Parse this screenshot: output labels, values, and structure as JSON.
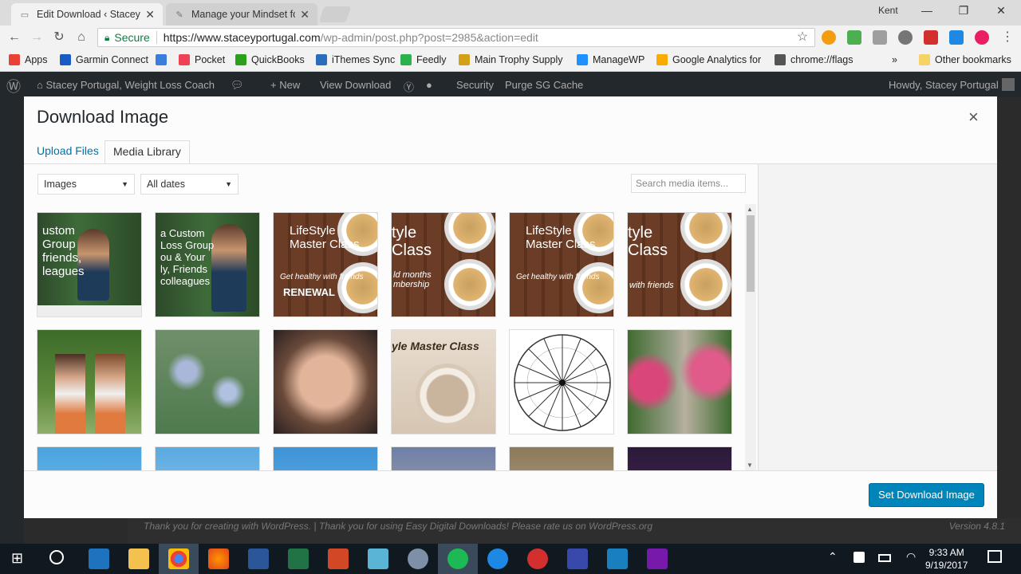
{
  "browser": {
    "tabs": [
      {
        "label": "Edit Download ‹ Stacey P",
        "icon": "document-icon"
      },
      {
        "label": "Manage your Mindset fo",
        "icon": "leaf-icon"
      }
    ],
    "profile": "Kent",
    "address": {
      "secure_label": "Secure",
      "host": "https://www.staceyportugal.com",
      "path": "/wp-admin/post.php?post=2985&action=edit"
    },
    "bookmarks": [
      {
        "label": "Apps",
        "color": "#e94235"
      },
      {
        "label": "Garmin Connect",
        "color": "#1a5bc4"
      },
      {
        "label": "",
        "color": "#3b7ddd"
      },
      {
        "label": "Pocket",
        "color": "#ef4056"
      },
      {
        "label": "QuickBooks",
        "color": "#2ca01c"
      },
      {
        "label": "iThemes Sync",
        "color": "#2a6ebb"
      },
      {
        "label": "Feedly",
        "color": "#2bb24c"
      },
      {
        "label": "Main Trophy Supply",
        "color": "#d4a017"
      },
      {
        "label": "ManageWP",
        "color": "#1e90ff"
      },
      {
        "label": "Google Analytics for",
        "color": "#f9ab00"
      },
      {
        "label": "chrome://flags",
        "color": "#555555"
      }
    ],
    "bookmarks_more": "»",
    "other_bookmarks": "Other bookmarks"
  },
  "wp_admin_bar": {
    "site_name": "Stacey Portugal, Weight Loss Coach",
    "new_label": "New",
    "view_label": "View Download",
    "security_label": "Security",
    "purge_label": "Purge SG Cache",
    "howdy": "Howdy, Stacey Portugal"
  },
  "wp_footer": {
    "left": "Thank you for creating with WordPress. | Thank you for using Easy Digital Downloads! Please rate us on WordPress.org",
    "version": "Version 4.8.1"
  },
  "modal": {
    "title": "Download Image",
    "close": "×",
    "tabs": [
      "Upload Files",
      "Media Library"
    ],
    "filter_type": "Images",
    "filter_date": "All dates",
    "search_placeholder": "Search media items...",
    "set_button": "Set Download Image",
    "thumbnails": [
      {
        "caption": "ustom\nGroup\nfriends,\nleagues",
        "sub": ""
      },
      {
        "caption": "a Custom\nLoss Group\nou & Your\nly, Friends\ncolleagues",
        "sub": ""
      },
      {
        "caption": "LifeStyle\nMaster Class",
        "sub": "Get healthy with friends",
        "badge": "RENEWAL"
      },
      {
        "caption": "tyle\nClass",
        "sub": "ld months\nmbership"
      },
      {
        "caption": "LifeStyle\nMaster Class",
        "sub": "Get healthy with friends"
      },
      {
        "caption": "tyle\nClass",
        "sub": "with friends"
      },
      {
        "caption": "",
        "sub": ""
      },
      {
        "caption": "",
        "sub": ""
      },
      {
        "caption": "",
        "sub": ""
      },
      {
        "caption": "yle Master Class",
        "sub": ""
      },
      {
        "caption": "",
        "sub": ""
      },
      {
        "caption": "",
        "sub": ""
      }
    ]
  },
  "taskbar": {
    "time": "9:33 AM",
    "date": "9/19/2017"
  }
}
